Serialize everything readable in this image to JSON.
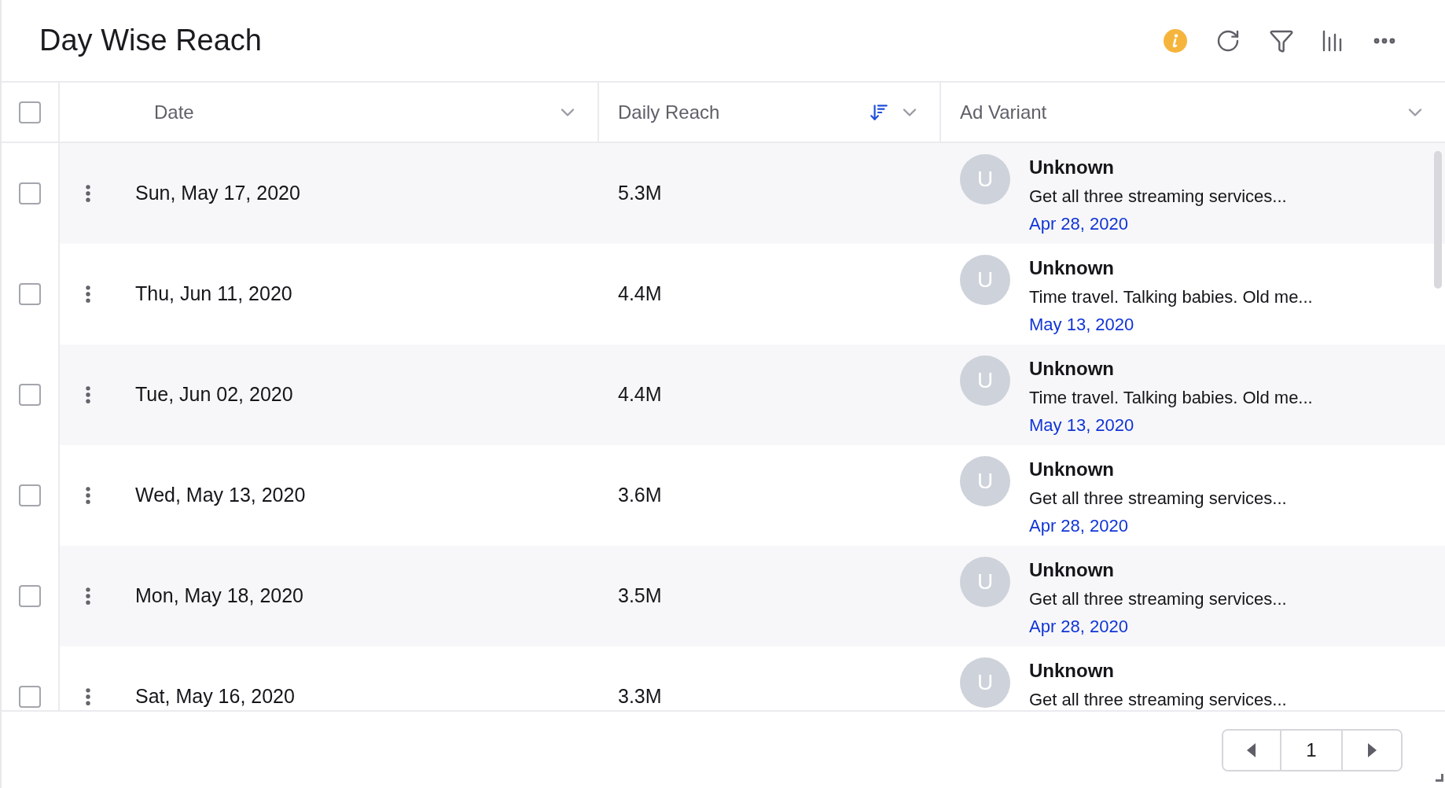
{
  "title": "Day Wise Reach",
  "table": {
    "select_all": {
      "checked": false
    },
    "columns": [
      {
        "label": "Date",
        "sorted": false
      },
      {
        "label": "Daily Reach",
        "sorted": true
      },
      {
        "label": "Ad Variant",
        "sorted": false
      }
    ],
    "rows": [
      {
        "checked": false,
        "date": "Sun, May 17, 2020",
        "reach": "5.3M",
        "avatar": "U",
        "variant_name": "Unknown",
        "variant_text": "Get all three streaming services...",
        "variant_date": "Apr 28, 2020"
      },
      {
        "checked": false,
        "date": "Thu, Jun 11, 2020",
        "reach": "4.4M",
        "avatar": "U",
        "variant_name": "Unknown",
        "variant_text": "Time travel. Talking babies. Old me...",
        "variant_date": "May 13, 2020"
      },
      {
        "checked": false,
        "date": "Tue, Jun 02, 2020",
        "reach": "4.4M",
        "avatar": "U",
        "variant_name": "Unknown",
        "variant_text": "Time travel. Talking babies. Old me...",
        "variant_date": "May 13, 2020"
      },
      {
        "checked": false,
        "date": "Wed, May 13, 2020",
        "reach": "3.6M",
        "avatar": "U",
        "variant_name": "Unknown",
        "variant_text": "Get all three streaming services...",
        "variant_date": "Apr 28, 2020"
      },
      {
        "checked": false,
        "date": "Mon, May 18, 2020",
        "reach": "3.5M",
        "avatar": "U",
        "variant_name": "Unknown",
        "variant_text": "Get all three streaming services...",
        "variant_date": "Apr 28, 2020"
      },
      {
        "checked": false,
        "date": "Sat, May 16, 2020",
        "reach": "3.3M",
        "avatar": "U",
        "variant_name": "Unknown",
        "variant_text": "Get all three streaming services..."
      }
    ]
  },
  "pagination": {
    "page": "1"
  }
}
